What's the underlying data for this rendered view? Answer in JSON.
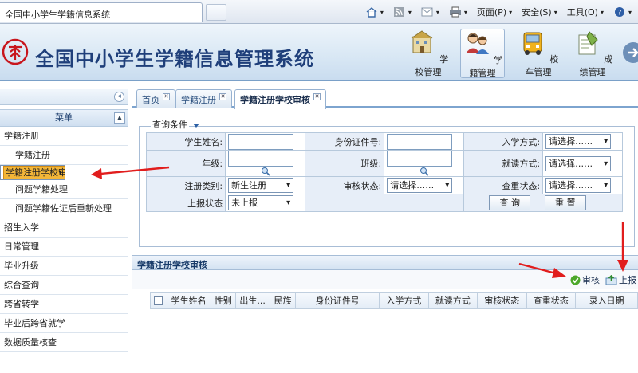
{
  "browser": {
    "tab_title": "全国中小学生学籍信息系统",
    "tools": [
      {
        "icon": "home-icon",
        "label": ""
      },
      {
        "icon": "rss-feed-icon",
        "label": ""
      },
      {
        "icon": "mail-icon",
        "label": ""
      },
      {
        "icon": "print-icon",
        "label": ""
      },
      {
        "icon": "",
        "label": "页面(P)"
      },
      {
        "icon": "",
        "label": "安全(S)"
      },
      {
        "icon": "",
        "label": "工具(O)"
      },
      {
        "icon": "help-icon",
        "label": ""
      }
    ]
  },
  "app": {
    "title": "全国中小学生学籍信息管理系统",
    "nav": [
      {
        "label": "学校管理",
        "icon": "school-management-icon"
      },
      {
        "label": "学籍管理",
        "icon": "student-records-icon",
        "active": true
      },
      {
        "label": "校车管理",
        "icon": "school-bus-icon"
      },
      {
        "label": "成绩管理",
        "icon": "grades-icon"
      }
    ]
  },
  "sidebar": {
    "menu_title": "菜单",
    "groups": {
      "registration": "学籍注册",
      "enrollment": "招生入学",
      "daily": "日常管理",
      "graduation": "毕业升级",
      "query": "综合查询",
      "transfer": "跨省转学",
      "post_grad": "毕业后跨省就学",
      "quality": "数据质量核查"
    },
    "sub_items": {
      "register": "学籍注册",
      "school_review": "学籍注册学校审核",
      "problem": "问题学籍处理",
      "reprocess": "问题学籍佐证后重新处理"
    }
  },
  "tabs": {
    "home": "首页",
    "register": "学籍注册",
    "review": "学籍注册学校审核"
  },
  "query": {
    "legend": "查询条件",
    "student_name_label": "学生姓名:",
    "id_number_label": "身份证件号:",
    "enroll_method_label": "入学方式:",
    "grade_label": "年级:",
    "class_label": "班级:",
    "study_method_label": "就读方式:",
    "reg_type_label": "注册类别:",
    "review_status_label": "审核状态:",
    "dup_status_label": "查重状态:",
    "report_status_label": "上报状态",
    "enroll_method_value": "请选择……",
    "study_method_value": "请选择……",
    "reg_type_value": "新生注册",
    "review_status_value": "请选择……",
    "dup_status_value": "请选择……",
    "report_status_value": "未上报",
    "search_button": "查 询",
    "reset_button": "重 置"
  },
  "list": {
    "title": "学籍注册学校审核",
    "review_button": "审核",
    "report_button": "上报",
    "columns": {
      "name": "学生姓名",
      "gender": "性别",
      "birth": "出生...",
      "ethnicity": "民族",
      "id": "身份证件号",
      "enroll": "入学方式",
      "study": "就读方式",
      "review": "审核状态",
      "dup": "查重状态",
      "entry_date": "录入日期"
    }
  },
  "colors": {
    "accent": "#2b5fa4",
    "highlight": "#f3b638",
    "annotation": "#e11d1d"
  }
}
